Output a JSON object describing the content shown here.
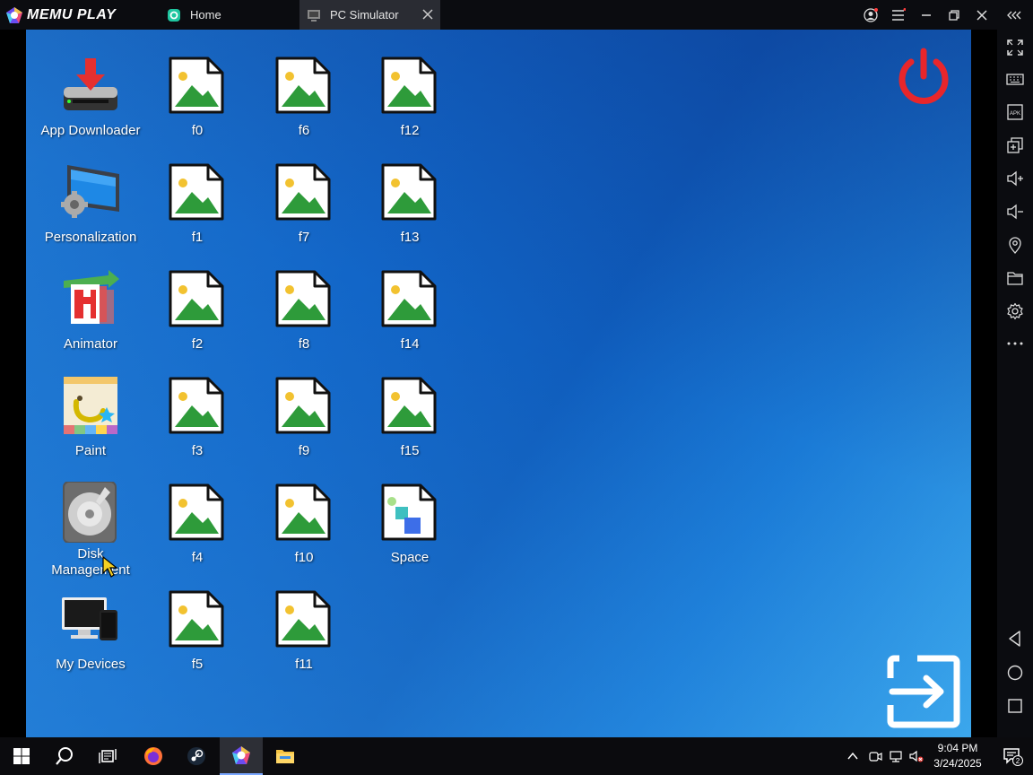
{
  "titlebar": {
    "logo_text": "MEMU PLAY",
    "tabs": [
      {
        "label": "Home"
      },
      {
        "label": "PC Simulator"
      }
    ]
  },
  "desktop": {
    "icons": {
      "app_downloader": "App Downloader",
      "personalization": "Personalization",
      "animator": "Animator",
      "paint": "Paint",
      "disk_management": "Disk Management",
      "my_devices": "My Devices",
      "space": "Space"
    },
    "files": [
      "f0",
      "f1",
      "f2",
      "f3",
      "f4",
      "f5",
      "f6",
      "f7",
      "f8",
      "f9",
      "f10",
      "f11",
      "f12",
      "f13",
      "f14",
      "f15"
    ]
  },
  "right_toolbar": {
    "items": [
      "fullscreen-icon",
      "keyboard-icon",
      "apk-icon",
      "multi-window-icon",
      "volume-up-icon",
      "volume-down-icon",
      "location-icon",
      "folder-icon",
      "settings-icon",
      "more-icon",
      "back-icon",
      "home-icon",
      "recents-icon"
    ],
    "apk_label": "APK"
  },
  "taskbar": {
    "clock_time": "9:04 PM",
    "clock_date": "3/24/2025",
    "notification_count": "2"
  },
  "colors": {
    "power_red": "#e8262b",
    "desktop_blue": "#1266c8",
    "file_green": "#2e9b3a",
    "file_sun": "#f2c230"
  }
}
